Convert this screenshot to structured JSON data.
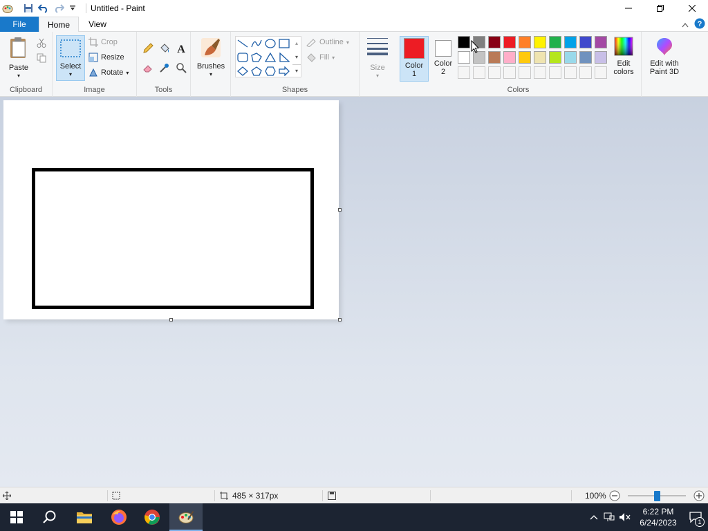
{
  "window": {
    "title": "Untitled - Paint",
    "quick_access": [
      "save-icon",
      "undo-icon",
      "redo-icon",
      "customize-dropdown-icon"
    ]
  },
  "tabs": {
    "file": "File",
    "home": "Home",
    "view": "View"
  },
  "ribbon": {
    "clipboard": {
      "label": "Clipboard",
      "paste": "Paste"
    },
    "image": {
      "label": "Image",
      "select": "Select",
      "crop": "Crop",
      "resize": "Resize",
      "rotate": "Rotate"
    },
    "tools": {
      "label": "Tools"
    },
    "brushes": {
      "label": "Brushes"
    },
    "shapes": {
      "label": "Shapes",
      "outline": "Outline",
      "fill": "Fill"
    },
    "size": {
      "label": "Size"
    },
    "colors": {
      "label": "Colors",
      "color1_label": "Color",
      "color1_num": "1",
      "color2_label": "Color",
      "color2_num": "2",
      "color1_value": "#ed1c24",
      "color2_value": "#ffffff",
      "edit_colors_line1": "Edit",
      "edit_colors_line2": "colors",
      "paint3d_line1": "Edit with",
      "paint3d_line2": "Paint 3D",
      "palette_row1": [
        "#000000",
        "#7f7f7f",
        "#880015",
        "#ed1c24",
        "#ff7f27",
        "#fff200",
        "#22b14c",
        "#00a2e8",
        "#3f48cc",
        "#a349a4"
      ],
      "palette_row2": [
        "#ffffff",
        "#c3c3c3",
        "#b97a57",
        "#ffaec9",
        "#ffc90e",
        "#efe4b0",
        "#b5e61d",
        "#99d9ea",
        "#7092be",
        "#c8bfe7"
      ],
      "palette_row3": [
        "#f5f5f5",
        "#f5f5f5",
        "#f5f5f5",
        "#f5f5f5",
        "#f5f5f5",
        "#f5f5f5",
        "#f5f5f5",
        "#f5f5f5",
        "#f5f5f5",
        "#f5f5f5"
      ]
    }
  },
  "status": {
    "canvas_size": "485 × 317px",
    "zoom": "100%"
  },
  "taskbar": {
    "time": "6:22 PM",
    "date": "6/24/2023",
    "notifications": "1"
  }
}
